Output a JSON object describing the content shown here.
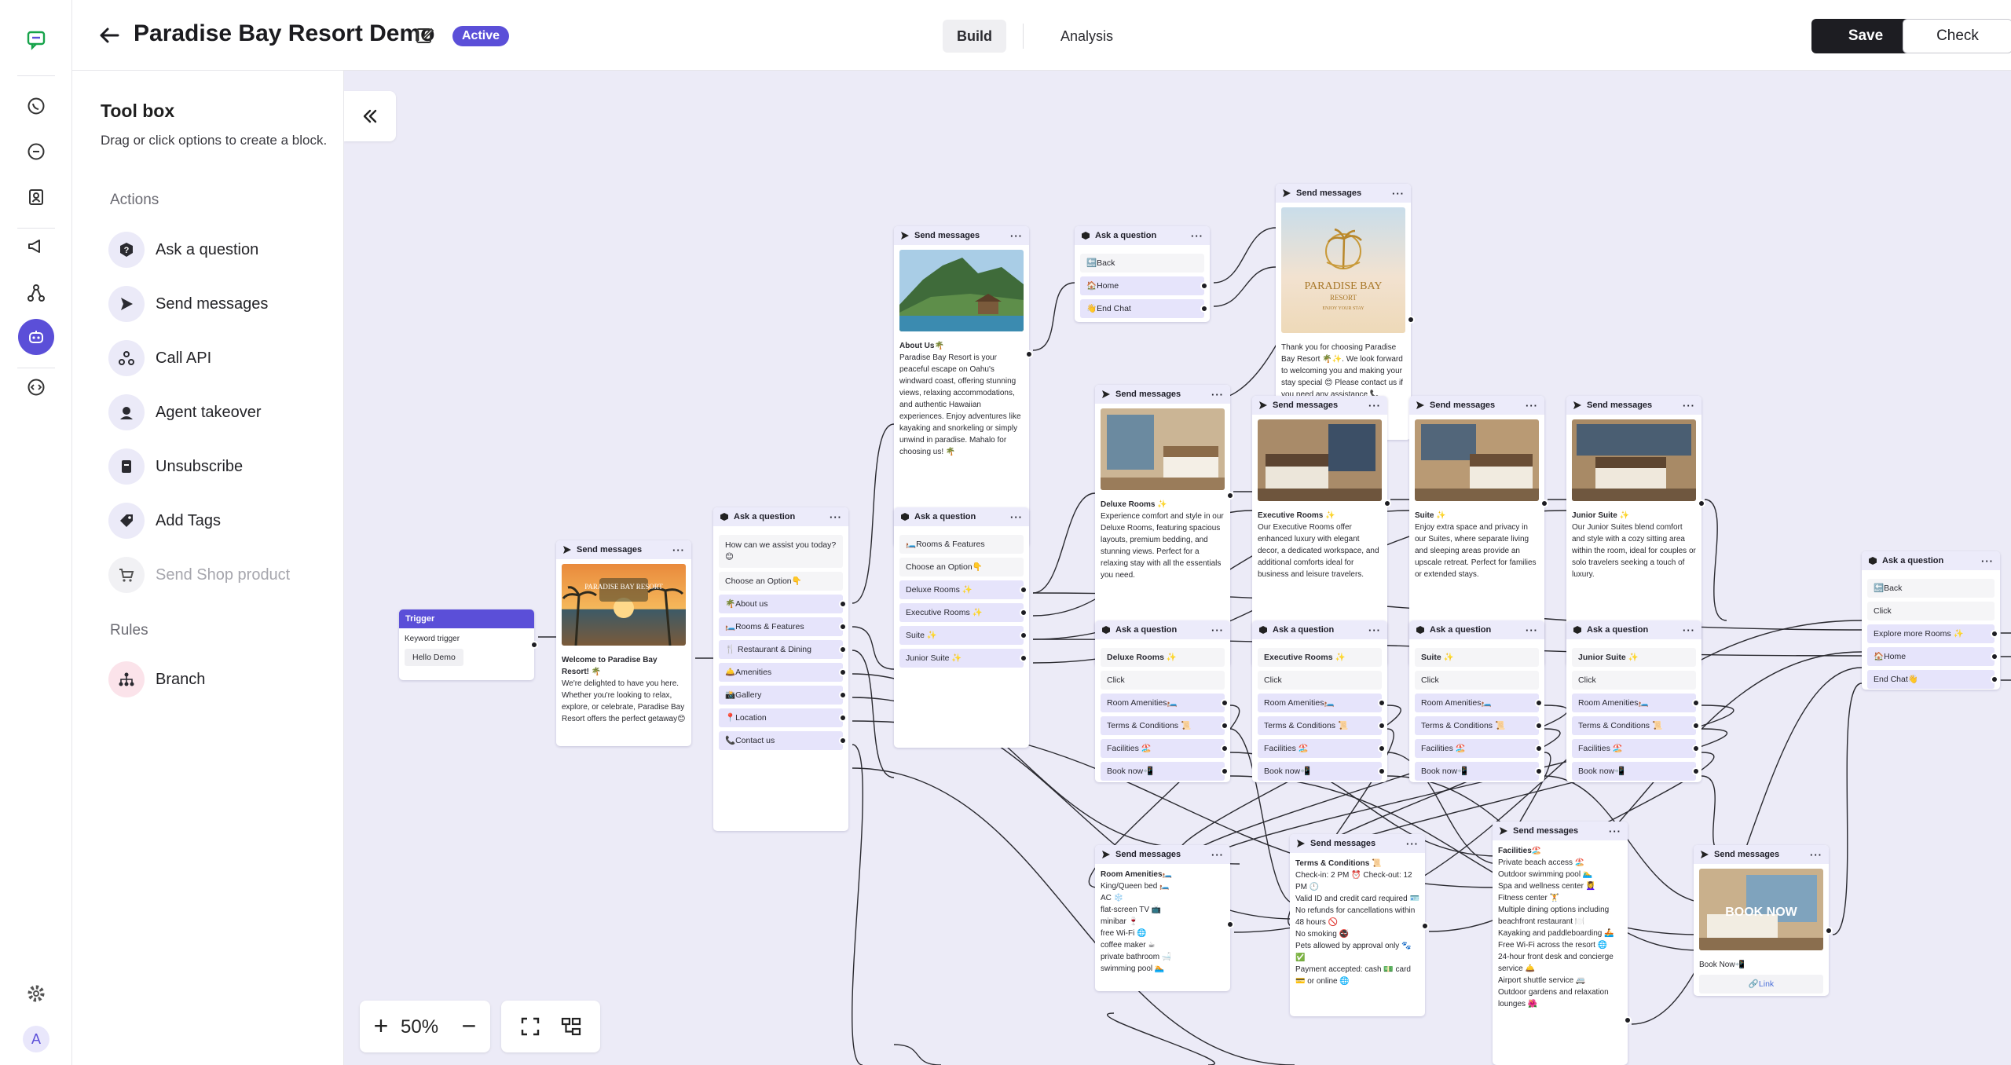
{
  "header": {
    "title": "Paradise Bay Resort Demo",
    "status": "Active",
    "tabs": [
      "Build",
      "Analysis"
    ],
    "save_label": "Save",
    "check_label": "Check"
  },
  "toolbox": {
    "title": "Tool box",
    "subtitle": "Drag or click options to create a block.",
    "actions_label": "Actions",
    "actions": [
      {
        "label": "Ask a question",
        "icon": "question-icon"
      },
      {
        "label": "Send messages",
        "icon": "send-icon"
      },
      {
        "label": "Call API",
        "icon": "api-icon"
      },
      {
        "label": "Agent takeover",
        "icon": "agent-icon"
      },
      {
        "label": "Unsubscribe",
        "icon": "unsubscribe-icon"
      },
      {
        "label": "Add Tags",
        "icon": "tag-icon"
      },
      {
        "label": "Send Shop product",
        "icon": "cart-icon",
        "disabled": true
      }
    ],
    "rules_label": "Rules",
    "rules": [
      {
        "label": "Branch",
        "icon": "branch-icon"
      }
    ]
  },
  "rail": {
    "avatar_letter": "A",
    "icons": [
      "chat-logo-icon",
      "whatsapp-icon",
      "chat-bubble-icon",
      "contacts-icon",
      "megaphone-icon",
      "flow-icon",
      "bot-icon",
      "code-icon",
      "settings-icon"
    ]
  },
  "canvas": {
    "zoom": "50%",
    "trigger": {
      "title": "Trigger",
      "label": "Keyword trigger",
      "keyword": "Hello Demo"
    },
    "welcome": {
      "header": "Send messages",
      "title": "Welcome to Paradise Bay Resort! 🌴",
      "text": "We're delighted to have you here. Whether you're looking to relax, explore, or celebrate, Paradise Bay Resort offers the perfect getaway😊",
      "image_text": "PARADISE BAY RESORT"
    },
    "main_menu": {
      "header": "Ask a question",
      "prompt": "How can we assist you today?😊",
      "hint": "Choose an Option👇",
      "options": [
        "🌴About us",
        "🛏️Rooms & Features",
        "🍴 Restaurant & Dining",
        "🛎️Amenities",
        "📸Gallery",
        "📍Location",
        "📞Contact us"
      ]
    },
    "about": {
      "header": "Send messages",
      "title": "About Us🌴",
      "text": "Paradise Bay Resort is your peaceful escape on Oahu's windward coast, offering stunning views, relaxing accommodations, and authentic Hawaiian experiences. Enjoy adventures like kayaking and snorkeling or simply unwind in paradise. Mahalo for choosing us! 🌴"
    },
    "nav1": {
      "header": "Ask a question",
      "options": [
        "🔙Back",
        "🏠Home",
        "👋End Chat"
      ]
    },
    "thanks": {
      "header": "Send messages",
      "logo_line1": "PARADISE BAY",
      "logo_line2": "RESORT",
      "logo_line3": "ENJOY YOUR STAY",
      "text": "Thank you for choosing Paradise Bay Resort 🌴✨. We look forward to welcoming you and making your stay special 😊 Please contact us if you need any assistance 📞"
    },
    "rooms_menu": {
      "header": "Ask a question",
      "title": "🛏️Rooms & Features",
      "hint": "Choose an Option👇",
      "options": [
        "Deluxe Rooms ✨",
        "Executive Rooms ✨",
        "Suite ✨",
        "Junior Suite ✨"
      ]
    },
    "room_msgs": [
      {
        "header": "Send messages",
        "title": "Deluxe Rooms ✨",
        "text": "Experience comfort and style in our Deluxe Rooms, featuring spacious layouts, premium bedding, and stunning views. Perfect for a relaxing stay with all the essentials you need."
      },
      {
        "header": "Send messages",
        "title": "Executive Rooms ✨",
        "text": "Our Executive Rooms offer enhanced luxury with elegant decor, a dedicated workspace, and additional comforts ideal for business and leisure travelers."
      },
      {
        "header": "Send messages",
        "title": "Suite ✨",
        "text": "Enjoy extra space and privacy in our Suites, where separate living and sleeping areas provide an upscale retreat. Perfect for families or extended stays."
      },
      {
        "header": "Send messages",
        "title": "Junior Suite ✨",
        "text": "Our Junior Suites blend comfort and style with a cozy sitting area within the room, ideal for couples or solo travelers seeking a touch of luxury."
      }
    ],
    "room_qs": [
      {
        "header": "Ask a question",
        "title": "Deluxe Rooms ✨",
        "click": "Click",
        "options": [
          "Room Amenities🛏️",
          "Terms & Conditions 📜",
          "Facilities 🏖️",
          "Book now📲"
        ]
      },
      {
        "header": "Ask a question",
        "title": "Executive Rooms ✨",
        "click": "Click",
        "options": [
          "Room Amenities🛏️",
          "Terms & Conditions 📜",
          "Facilities 🏖️",
          "Book now📲"
        ]
      },
      {
        "header": "Ask a question",
        "title": "Suite ✨",
        "click": "Click",
        "options": [
          "Room Amenities🛏️",
          "Terms & Conditions 📜",
          "Facilities 🏖️",
          "Book now📲"
        ]
      },
      {
        "header": "Ask a question",
        "title": "Junior Suite ✨",
        "click": "Click",
        "options": [
          "Room Amenities🛏️",
          "Terms & Conditions 📜",
          "Facilities 🏖️",
          "Book now📲"
        ]
      }
    ],
    "nav2": {
      "header": "Ask a question",
      "back": "🔙Back",
      "click": "Click",
      "options": [
        "Explore more Rooms ✨",
        "🏠Home",
        "End Chat👋"
      ]
    },
    "amenities": {
      "header": "Send messages",
      "title": "Room Amenities🛏️",
      "lines": [
        "King/Queen bed 🛏️",
        "AC ❄️",
        "flat-screen TV 📺",
        "minibar 🍷",
        "free Wi-Fi 🌐",
        "coffee maker ☕",
        "private bathroom 🛁",
        "swimming pool 🏊"
      ]
    },
    "terms": {
      "header": "Send messages",
      "title": "Terms & Conditions 📜",
      "lines": [
        "Check-in: 2 PM ⏰ Check-out: 12 PM 🕛",
        "Valid ID and credit card required 🪪",
        "No refunds for cancellations within 48 hours 🚫",
        "No smoking 🚭",
        "Pets allowed by approval only 🐾✅",
        "Payment accepted: cash 💵 card 💳 or online 🌐"
      ]
    },
    "facilities": {
      "header": "Send messages",
      "title": "Facilities🏖️",
      "lines": [
        "Private beach access 🏖️",
        "Outdoor swimming pool 🏊‍♂️",
        "Spa and wellness center 💆‍♀️",
        "Fitness center 🏋️",
        "Multiple dining options including beachfront restaurant 🍽️",
        "Kayaking and paddleboarding 🚣",
        "Free Wi-Fi across the resort 🌐",
        "24-hour front desk and concierge service 🛎️",
        "Airport shuttle service 🚐",
        "Outdoor gardens and relaxation lounges 🌺"
      ]
    },
    "booknow": {
      "header": "Send messages",
      "image_text": "BOOK NOW",
      "caption": "Book Now📲",
      "link": "🔗Link"
    }
  },
  "colors": {
    "accent": "#5b4fd8",
    "canvas": "#ecebf7",
    "option_bg": "#e6e4fb",
    "header_bg": "#ecebfa"
  }
}
